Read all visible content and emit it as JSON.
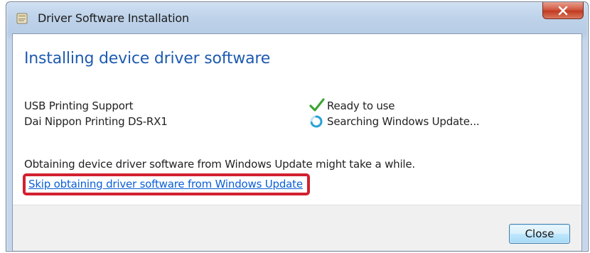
{
  "window": {
    "title": "Driver Software Installation",
    "close_glyph": "x"
  },
  "main": {
    "heading": "Installing device driver software",
    "devices": [
      {
        "name": "USB Printing Support",
        "status": "Ready to use",
        "status_icon": "green-check-icon"
      },
      {
        "name": "Dai Nippon Printing DS-RX1",
        "status": "Searching Windows Update...",
        "status_icon": "searching-spinner-icon"
      }
    ],
    "notice": "Obtaining device driver software from Windows Update might take a while.",
    "skip_link": "Skip obtaining driver software from Windows Update"
  },
  "footer": {
    "close_label": "Close"
  },
  "colors": {
    "heading": "#1e5bb0",
    "link": "#0b5fd6",
    "highlight": "#d2202f",
    "check": "#3fa535",
    "spinner": "#29a3d6"
  }
}
